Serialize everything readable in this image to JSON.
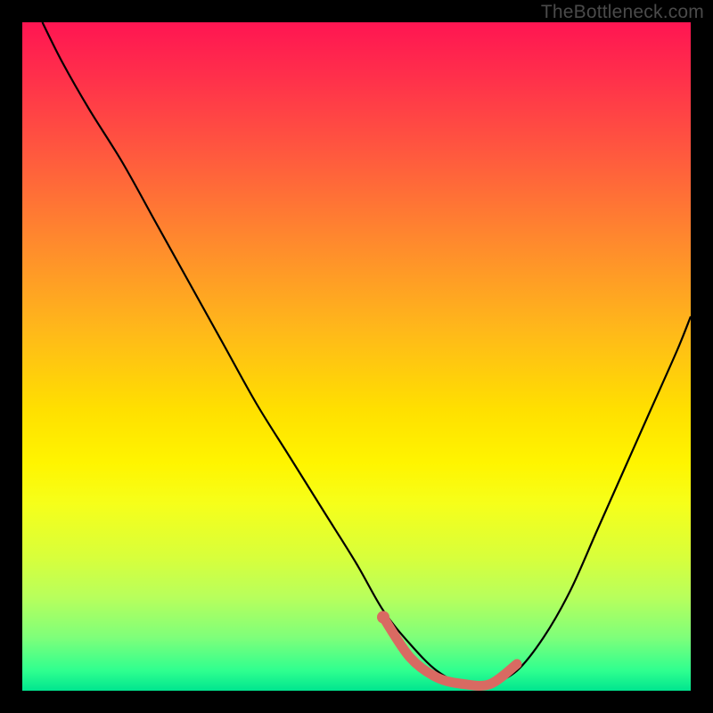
{
  "watermark": "TheBottleneck.com",
  "chart_data": {
    "type": "line",
    "title": "",
    "xlabel": "",
    "ylabel": "",
    "xlim": [
      0,
      100
    ],
    "ylim": [
      0,
      100
    ],
    "gradient_stops": [
      {
        "offset": 0,
        "color": "#ff1552"
      },
      {
        "offset": 8,
        "color": "#ff2f4b"
      },
      {
        "offset": 20,
        "color": "#ff5a3e"
      },
      {
        "offset": 33,
        "color": "#ff8a2d"
      },
      {
        "offset": 46,
        "color": "#ffb81a"
      },
      {
        "offset": 58,
        "color": "#ffe000"
      },
      {
        "offset": 66,
        "color": "#fff500"
      },
      {
        "offset": 72,
        "color": "#f6ff1a"
      },
      {
        "offset": 80,
        "color": "#d8ff3b"
      },
      {
        "offset": 86,
        "color": "#b8ff5c"
      },
      {
        "offset": 92,
        "color": "#7fff7a"
      },
      {
        "offset": 97,
        "color": "#2fff8f"
      },
      {
        "offset": 100,
        "color": "#00e58f"
      }
    ],
    "series": [
      {
        "name": "main-curve",
        "color": "#000000",
        "x": [
          3,
          6,
          10,
          15,
          20,
          25,
          30,
          35,
          40,
          45,
          50,
          54,
          58,
          62,
          66,
          70,
          74,
          78,
          82,
          86,
          90,
          94,
          98,
          100
        ],
        "y": [
          100,
          94,
          87,
          79,
          70,
          61,
          52,
          43,
          35,
          27,
          19,
          12,
          7,
          3,
          1,
          1,
          3,
          8,
          15,
          24,
          33,
          42,
          51,
          56
        ]
      },
      {
        "name": "highlight-segment",
        "color": "#d96a62",
        "x": [
          54,
          58,
          62,
          66,
          70,
          74
        ],
        "y": [
          11,
          5,
          2,
          1,
          1,
          4
        ]
      }
    ],
    "highlight_dot": {
      "x": 54,
      "y": 11,
      "color": "#d96a62"
    }
  }
}
